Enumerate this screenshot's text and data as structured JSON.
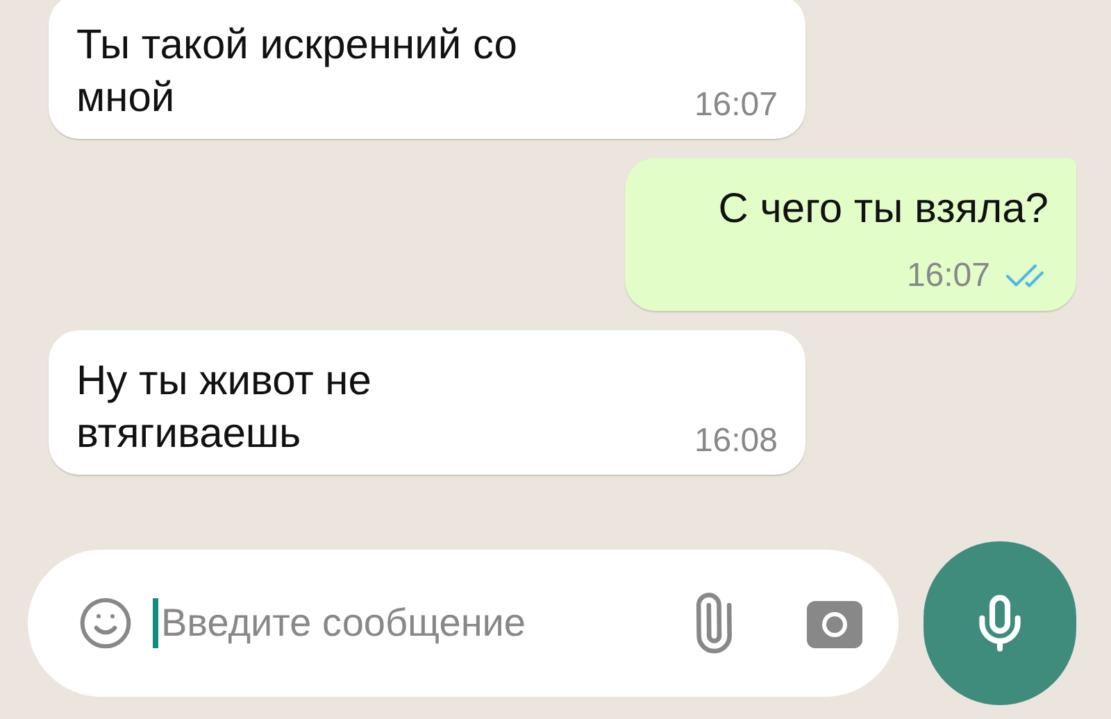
{
  "messages": [
    {
      "kind": "incoming",
      "text": "Ты такой искренний со мной",
      "time": "16:07"
    },
    {
      "kind": "outgoing",
      "text": "С чего ты взяла?",
      "time": "16:07",
      "read": true
    },
    {
      "kind": "incoming",
      "text": "Ну ты живот не втягиваешь",
      "time": "16:08"
    }
  ],
  "composer": {
    "placeholder": "Введите сообщение"
  }
}
